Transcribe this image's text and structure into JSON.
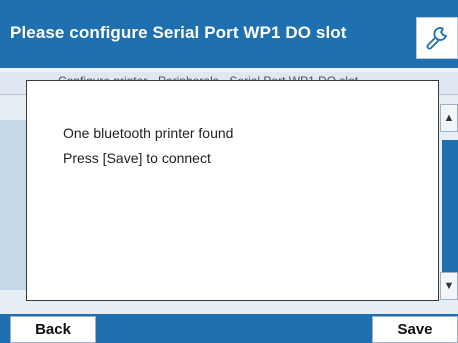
{
  "header": {
    "title": "Please configure Serial Port WP1 DO slot",
    "tool_icon": "wrench-icon"
  },
  "background": {
    "strip_text": "Configure printer - Peripherals - Serial Port WP1 DO slot"
  },
  "dialog": {
    "line1": "One bluetooth printer found",
    "line2": "Press [Save] to connect"
  },
  "footer": {
    "back_label": "Back",
    "save_label": "Save"
  },
  "colors": {
    "brand_blue": "#1f70b0",
    "panel": "#eef3f8"
  }
}
